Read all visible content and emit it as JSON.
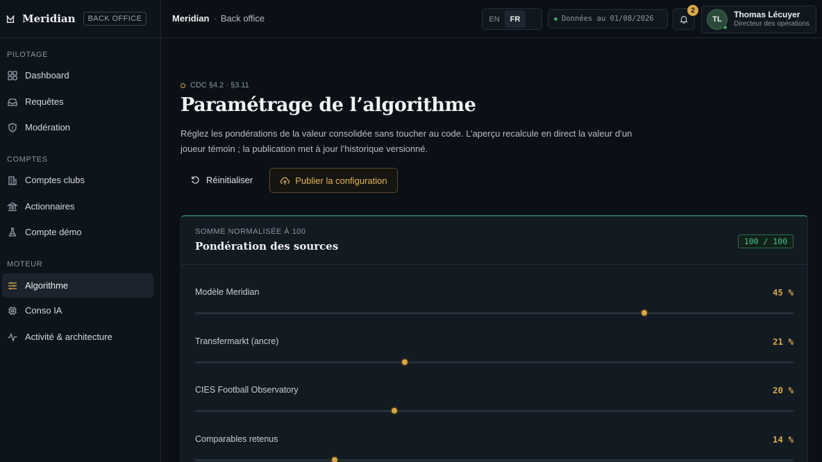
{
  "brand": {
    "name": "Meridian",
    "badge": "BACK OFFICE"
  },
  "sidebar": {
    "sections": [
      {
        "label": "PILOTAGE"
      },
      {
        "label": "COMPTES"
      },
      {
        "label": "MOTEUR"
      }
    ],
    "items": [
      {
        "label": "Dashboard",
        "icon": "dashboard-icon"
      },
      {
        "label": "Requêtes",
        "icon": "inbox-icon"
      },
      {
        "label": "Modération",
        "icon": "shield-icon"
      },
      {
        "label": "Comptes clubs",
        "icon": "building-icon"
      },
      {
        "label": "Actionnaires",
        "icon": "bank-icon"
      },
      {
        "label": "Compte démo",
        "icon": "flask-icon"
      },
      {
        "label": "Algorithme",
        "icon": "sliders-icon",
        "active": true
      },
      {
        "label": "Conso IA",
        "icon": "chip-icon"
      },
      {
        "label": "Activité & architecture",
        "icon": "activity-icon"
      }
    ]
  },
  "topbar": {
    "breadcrumb": [
      "Meridian",
      "Back office"
    ],
    "breadcrumb_sep": "·",
    "languages": [
      "EN",
      "FR"
    ],
    "active_language": "FR",
    "data_date": "Données au 01/08/2026",
    "notifications_count": "2",
    "user": {
      "initials": "TL",
      "name": "Thomas Lécuyer",
      "role": "Directeur des opérations"
    }
  },
  "main": {
    "reference": "CDC §4.2 · §3.11",
    "title": "Paramétrage de l’algorithme",
    "description": "Réglez les pondérations de la valeur consolidée sans toucher au code. L’aperçu recalcule en direct la valeur d’un joueur témoin ; la publication met à jour l’historique versionné.",
    "reset_label": "Réinitialiser",
    "publish_label": "Publier la configuration",
    "card": {
      "kicker": "SOMME NORMALISÉE À 100",
      "title": "Pondération des sources",
      "sum": "100 / 100",
      "sources": [
        {
          "label": "Modèle Meridian",
          "value": 45,
          "display": "45 %"
        },
        {
          "label": "Transfermarkt (ancre)",
          "value": 21,
          "display": "21 %"
        },
        {
          "label": "CIES Football Observatory",
          "value": 20,
          "display": "20 %"
        },
        {
          "label": "Comparables retenus",
          "value": 14,
          "display": "14 %"
        }
      ],
      "slider_max": 60
    }
  },
  "colors": {
    "accent": "#d9a84a",
    "success": "#52c08a",
    "background": "#0b1016"
  }
}
